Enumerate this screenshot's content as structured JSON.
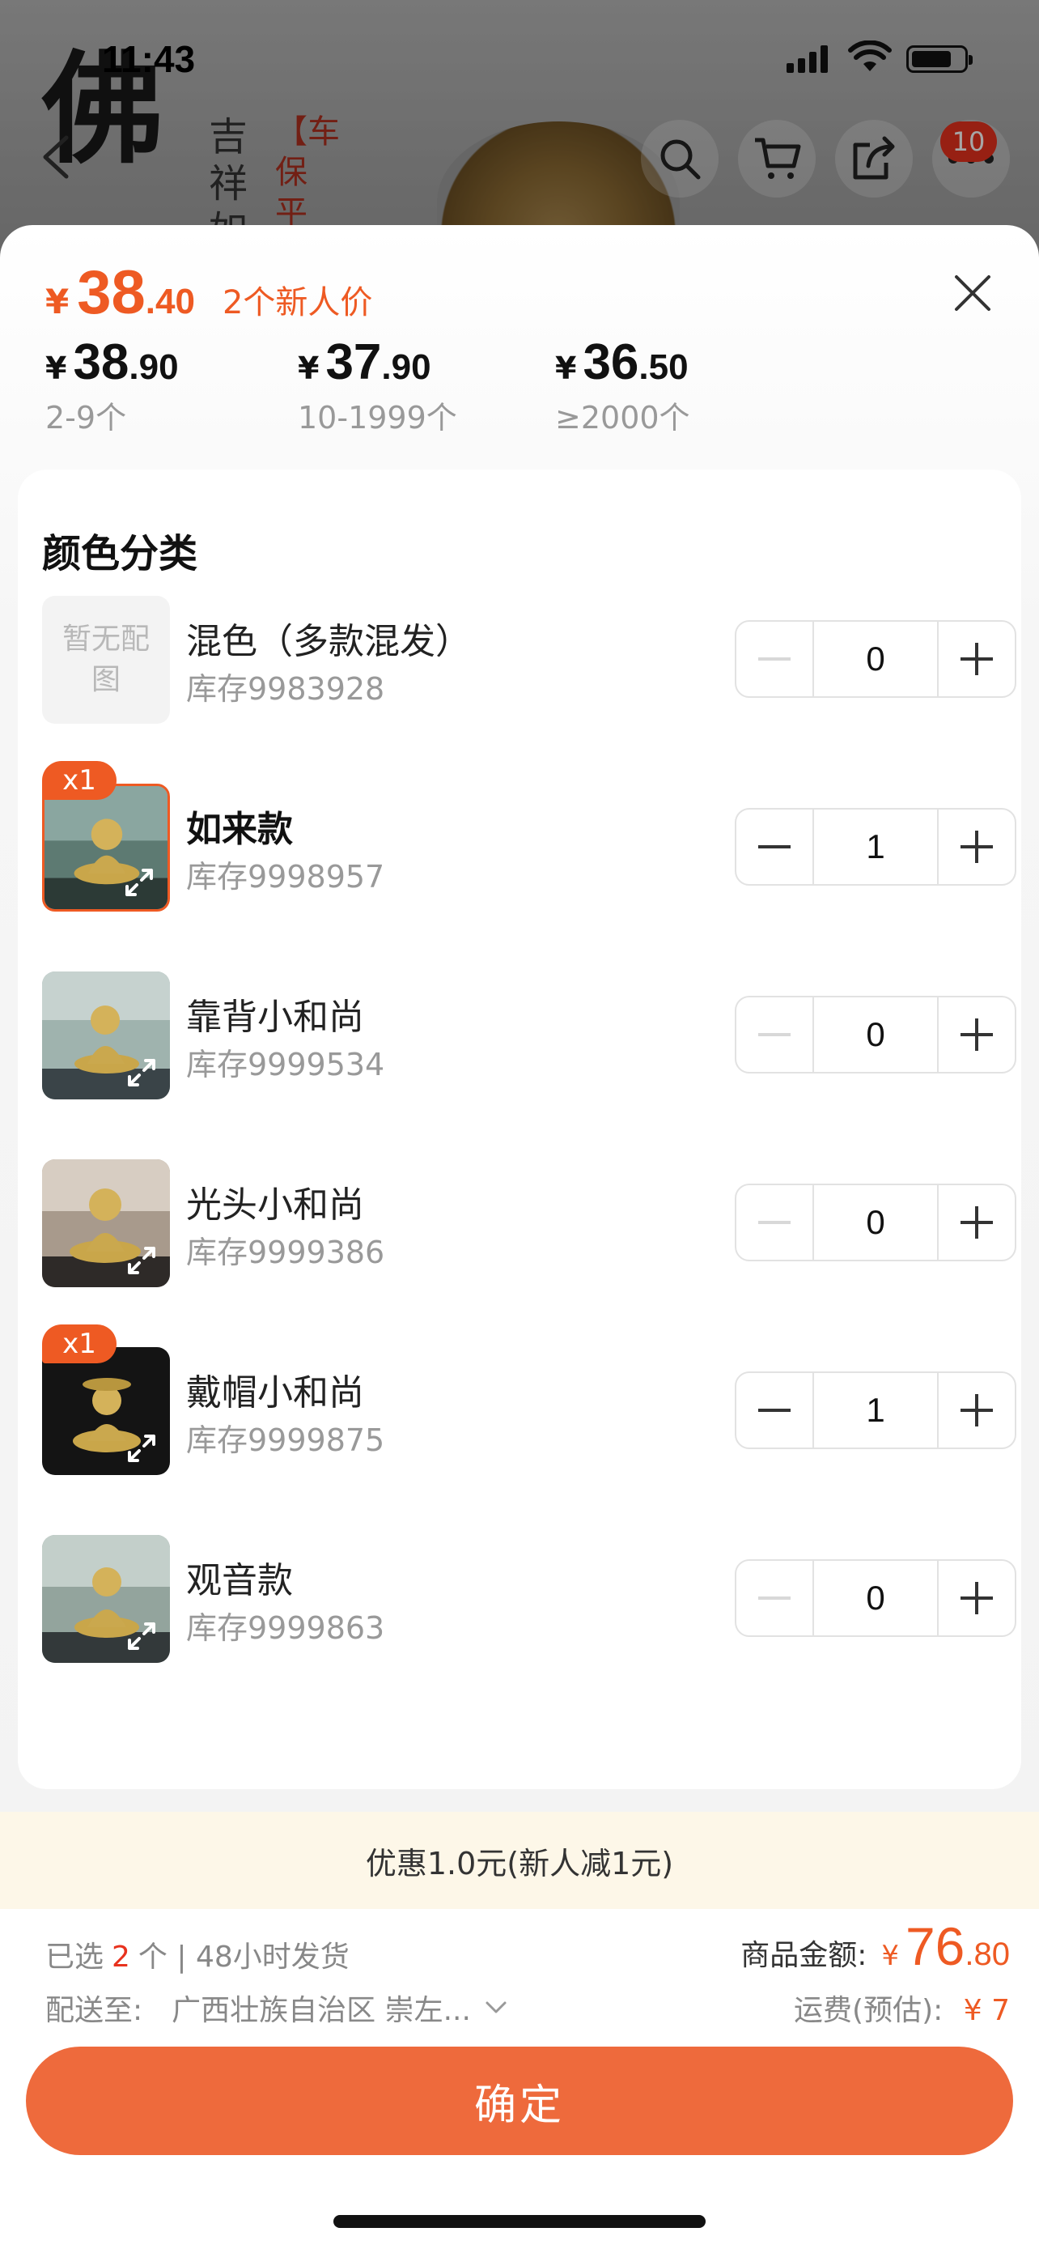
{
  "status_bar": {
    "time": "11:43"
  },
  "background_page": {
    "calligraphy": "佛",
    "vertical_text_1": "吉祥如",
    "vertical_text_2": "【车保平",
    "cart_badge": "10",
    "icons": [
      "back-icon",
      "search-icon",
      "cart-icon",
      "share-icon",
      "more-icon"
    ]
  },
  "sheet": {
    "head_price": {
      "yen": "¥",
      "int": "38",
      "dec": ".40",
      "promo": "2个新人价"
    },
    "tiers": [
      {
        "yen": "¥",
        "int": "38",
        "dec": ".90",
        "qty": "2-9个"
      },
      {
        "yen": "¥",
        "int": "37",
        "dec": ".90",
        "qty": "10-1999个"
      },
      {
        "yen": "¥",
        "int": "36",
        "dec": ".50",
        "qty": "≥2000个"
      }
    ],
    "section_title": "颜色分类",
    "options": [
      {
        "name": "混色（多款混发）",
        "stock": "库存9983928",
        "qty": "0",
        "placeholder": "暂无配图",
        "badge": "",
        "selected": false
      },
      {
        "name": "如来款",
        "stock": "库存9998957",
        "qty": "1",
        "badge": "x1",
        "selected": true
      },
      {
        "name": "靠背小和尚",
        "stock": "库存9999534",
        "qty": "0",
        "badge": "",
        "selected": false
      },
      {
        "name": "光头小和尚",
        "stock": "库存9999386",
        "qty": "0",
        "badge": "",
        "selected": false
      },
      {
        "name": "戴帽小和尚",
        "stock": "库存9999875",
        "qty": "1",
        "badge": "x1",
        "selected": true
      },
      {
        "name": "观音款",
        "stock": "库存9999863",
        "qty": "0",
        "badge": "",
        "selected": false
      }
    ],
    "discount": "优惠1.0元(新人减1元)",
    "summary": {
      "selected_prefix": "已选",
      "selected_count": "2",
      "selected_suffix": "个 | 48小时发货",
      "ship_label": "配送至:",
      "ship_address": "广西壮族自治区 崇左...",
      "amount_label": "商品金额:",
      "amount_yen": "¥",
      "amount_int": "76",
      "amount_dec": ".80",
      "freight_label": "运费(预估):",
      "freight_value": "¥ 7"
    },
    "confirm_label": "确定"
  },
  "colors": {
    "accent": "#ee5a23",
    "button": "#ee6a3c",
    "badge_red": "#e8321e"
  }
}
